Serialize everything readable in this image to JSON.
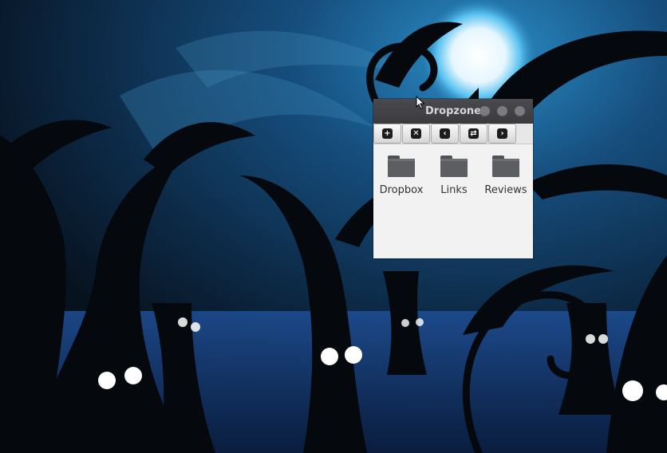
{
  "window": {
    "title": "Dropzone",
    "title_buttons": [
      "minimize",
      "maximize",
      "close"
    ]
  },
  "toolbar": {
    "buttons": [
      {
        "icon": "plus-icon",
        "glyph": "+"
      },
      {
        "icon": "close-x-icon",
        "glyph": "✕"
      },
      {
        "icon": "back-arrow-icon",
        "glyph": "‹"
      },
      {
        "icon": "swap-icon",
        "glyph": "⇄"
      },
      {
        "icon": "forward-arrow-icon",
        "glyph": "›"
      }
    ]
  },
  "files": [
    {
      "name": "Dropbox",
      "icon": "folder-icon"
    },
    {
      "name": "Links",
      "icon": "folder-icon"
    },
    {
      "name": "Reviews",
      "icon": "folder-icon"
    }
  ],
  "colors": {
    "titlebar": "#3f3f44",
    "window_bg": "#f2f2f2",
    "folder": "#5c5e62",
    "desktop": "#0a1a2c"
  }
}
